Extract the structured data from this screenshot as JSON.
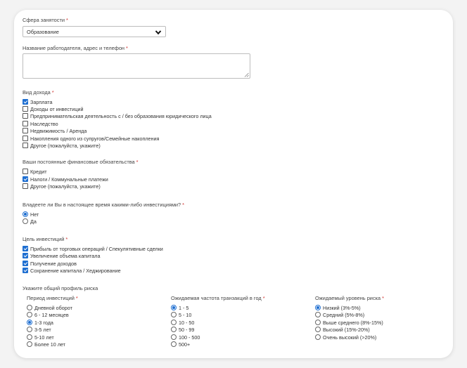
{
  "employment": {
    "label": "Сфера занятости",
    "required": "*",
    "selected": "Образование"
  },
  "employer": {
    "label": "Название работодателя, адрес и телефон",
    "required": "*",
    "value": ""
  },
  "income": {
    "label": "Вид дохода",
    "required": "*",
    "options": [
      {
        "label": "Зарплата",
        "checked": true
      },
      {
        "label": "Доходы от инвестиций",
        "checked": false
      },
      {
        "label": "Предпринимательская деятельность с / без образования юридического лица",
        "checked": false
      },
      {
        "label": "Наследство",
        "checked": false
      },
      {
        "label": "Недвижимость / Аренда",
        "checked": false
      },
      {
        "label": "Накопления одного из супругов/Семейные накопления",
        "checked": false
      },
      {
        "label": "Другое (пожалуйста, укажите)",
        "checked": false
      }
    ]
  },
  "obligations": {
    "label": "Ваши постоянные финансовые обязательства",
    "required": "*",
    "options": [
      {
        "label": "Кредит",
        "checked": false
      },
      {
        "label": "Налоги / Коммунальные платежи",
        "checked": true
      },
      {
        "label": "Другое (пожалуйста, укажите)",
        "checked": false
      }
    ]
  },
  "investments_now": {
    "label": "Владеете ли Вы в настоящее время какими-либо инвестициями?",
    "required": "*",
    "options": [
      {
        "label": "Нет",
        "selected": true
      },
      {
        "label": "Да",
        "selected": false
      }
    ]
  },
  "goal": {
    "label": "Цель инвестиций",
    "required": "*",
    "options": [
      {
        "label": "Прибыль от торговых операций / Спекулятивные сделки",
        "checked": true
      },
      {
        "label": "Увеличение объема капитала",
        "checked": true
      },
      {
        "label": "Получение доходов",
        "checked": true
      },
      {
        "label": "Сохранение капитала / Хеджирование",
        "checked": true
      }
    ]
  },
  "risk_profile": {
    "label": "Укажите общий профиль риска",
    "period": {
      "label": "Период инвестиций",
      "required": "*",
      "options": [
        {
          "label": "Дневной оборот",
          "selected": false
        },
        {
          "label": "6 - 12 месяцев",
          "selected": false
        },
        {
          "label": "1-3 года",
          "selected": true
        },
        {
          "label": "3-5 лет",
          "selected": false
        },
        {
          "label": "5-10 лет",
          "selected": false
        },
        {
          "label": "Более 10 лет",
          "selected": false
        }
      ]
    },
    "frequency": {
      "label": "Ожидаемая частота транзакций в год",
      "required": "*",
      "options": [
        {
          "label": "1 - 5",
          "selected": true
        },
        {
          "label": "5 - 10",
          "selected": false
        },
        {
          "label": "10 - 50",
          "selected": false
        },
        {
          "label": "50 - 99",
          "selected": false
        },
        {
          "label": "100 - 500",
          "selected": false
        },
        {
          "label": "500+",
          "selected": false
        }
      ]
    },
    "level": {
      "label": "Ожидаемый уровень риска",
      "required": "*",
      "options": [
        {
          "label": "Низкий (3%-5%)",
          "selected": true
        },
        {
          "label": "Средний (5%-8%)",
          "selected": false
        },
        {
          "label": "Выше среднего (8%-15%)",
          "selected": false
        },
        {
          "label": "Высокий (15%-20%)",
          "selected": false
        },
        {
          "label": "Очень высокий (>20%)",
          "selected": false
        }
      ]
    }
  },
  "colors": {
    "accent": "#1f6fd1",
    "required": "#d0312d"
  }
}
